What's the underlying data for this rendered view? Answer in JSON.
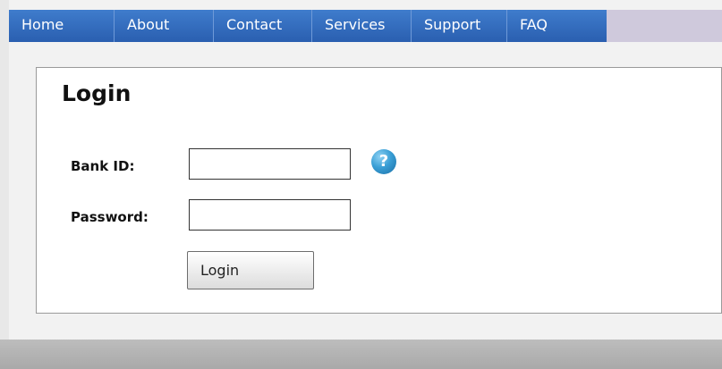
{
  "nav": {
    "items": [
      {
        "label": "Home"
      },
      {
        "label": "About"
      },
      {
        "label": "Contact"
      },
      {
        "label": "Services"
      },
      {
        "label": "Support"
      },
      {
        "label": "FAQ"
      }
    ]
  },
  "login": {
    "title": "Login",
    "bank_id_label": "Bank ID:",
    "bank_id_value": "",
    "password_label": "Password:",
    "password_value": "",
    "help_icon": "question-mark-icon",
    "help_symbol": "?",
    "button_label": "Login"
  },
  "colors": {
    "nav_blue": "#2a5fb0",
    "nav_end": "#cfc9dc",
    "help_blue": "#3a9fd6"
  }
}
